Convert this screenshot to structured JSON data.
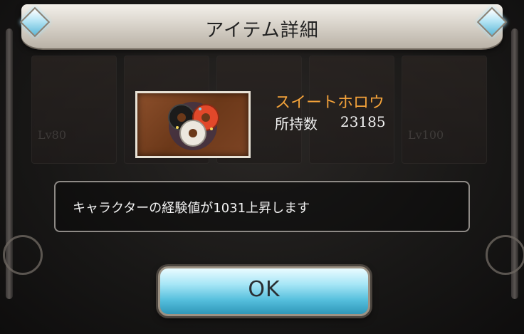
{
  "dialog": {
    "title": "アイテム詳細",
    "item": {
      "name": "スイートホロウ",
      "count_label": "所持数",
      "count_value": "23185",
      "icon": "candy-donut-item-icon"
    },
    "description": "キャラクターの経験値が1031上昇します",
    "ok_label": "OK"
  },
  "background": {
    "cards": [
      {
        "level": "Lv80"
      },
      {
        "level": ""
      },
      {
        "level": ""
      },
      {
        "level": ""
      },
      {
        "level": "Lv100"
      }
    ]
  },
  "colors": {
    "item_name": "#f3a23a",
    "text": "#f2f2f2",
    "button_accent": "#54bedc",
    "gem": "#bfe9f7"
  }
}
